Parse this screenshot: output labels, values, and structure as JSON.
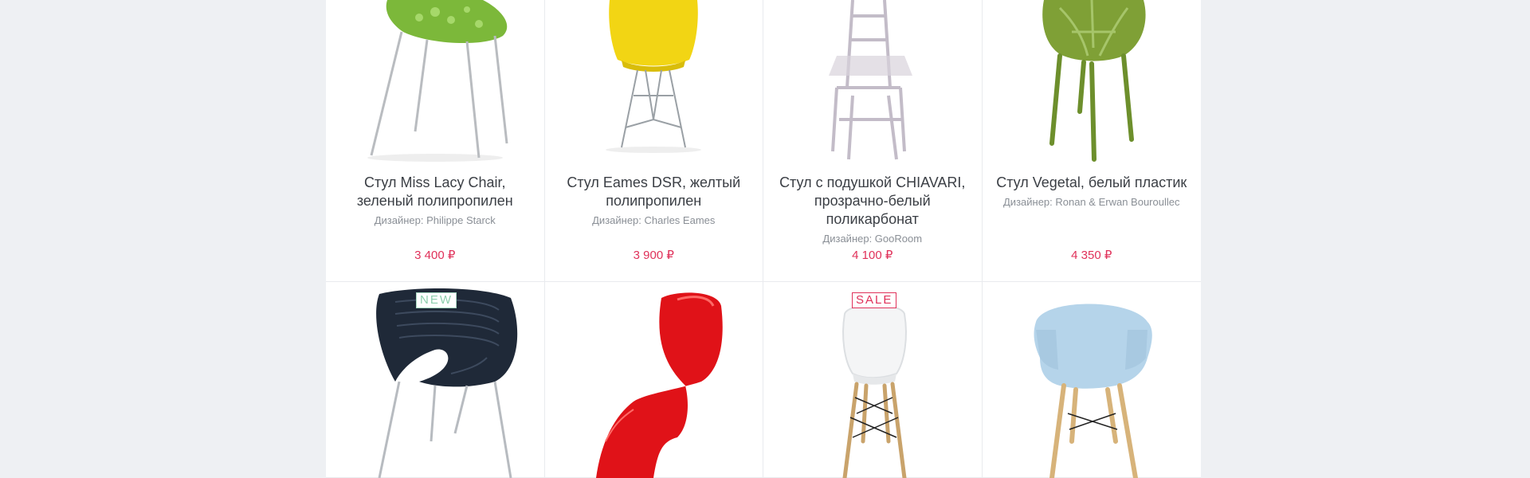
{
  "products": [
    {
      "title": "Стул Miss Lacy Chair, зеленый полипропилен",
      "designer": "Дизайнер: Philippe Starck",
      "price": "3 400 ₽",
      "icon": "green-lace-chair-image"
    },
    {
      "title": "Стул Eames DSR, желтый полипропилен",
      "designer": "Дизайнер: Charles Eames",
      "price": "3 900 ₽",
      "icon": "yellow-eames-chair-image"
    },
    {
      "title": "Стул с подушкой CHIAVARI, прозрачно-белый поликарбонат",
      "designer": "Дизайнер: GooRoom",
      "price": "4 100 ₽",
      "icon": "chiavari-chair-image"
    },
    {
      "title": "Стул Vegetal, белый пластик",
      "designer": "Дизайнер: Ronan & Erwan Bouroullec",
      "price": "4 350 ₽",
      "icon": "vegetal-chair-image"
    }
  ],
  "row2": [
    {
      "badge": "NEW",
      "icon": "black-ribbed-chair-image"
    },
    {
      "icon": "red-panton-chair-image"
    },
    {
      "badge": "SALE",
      "icon": "white-eiffel-chair-image"
    },
    {
      "icon": "blue-armchair-image"
    }
  ],
  "colors": {
    "price": "#e0315a",
    "new_badge": "#8ecfae",
    "page_bg": "#eef0f3"
  }
}
